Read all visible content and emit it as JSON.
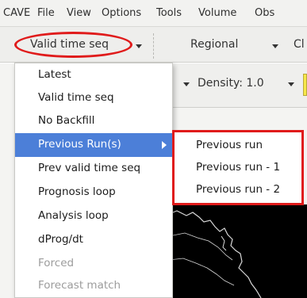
{
  "menubar": {
    "items": [
      "CAVE",
      "File",
      "View",
      "Options",
      "Tools",
      "Volume",
      "Obs"
    ]
  },
  "toolbar": {
    "frame_mode_label": "Valid time seq",
    "scale_label": "Regional",
    "partial_label": "Cl",
    "density_label": "Density: 1.0"
  },
  "dropdown": {
    "items": [
      {
        "label": "Latest",
        "enabled": true
      },
      {
        "label": "Valid time seq",
        "enabled": true
      },
      {
        "label": "No Backfill",
        "enabled": true
      },
      {
        "label": "Previous Run(s)",
        "enabled": true,
        "highlighted": true,
        "has_submenu": true
      },
      {
        "label": "Prev valid time seq",
        "enabled": true
      },
      {
        "label": "Prognosis loop",
        "enabled": true
      },
      {
        "label": "Analysis loop",
        "enabled": true
      },
      {
        "label": "dProg/dt",
        "enabled": true
      },
      {
        "label": "Forced",
        "enabled": false
      },
      {
        "label": "Forecast match",
        "enabled": false
      }
    ]
  },
  "submenu": {
    "items": [
      "Previous run",
      "Previous run - 1",
      "Previous run - 2"
    ]
  },
  "colors": {
    "highlight": "#4c7fd8",
    "annotation_red": "#e01b1b",
    "map_background": "#000000",
    "coastline": "#d8d8d8"
  },
  "icons": {
    "dropdown_arrow": "chevron-down-icon",
    "submenu_arrow": "chevron-right-icon"
  }
}
